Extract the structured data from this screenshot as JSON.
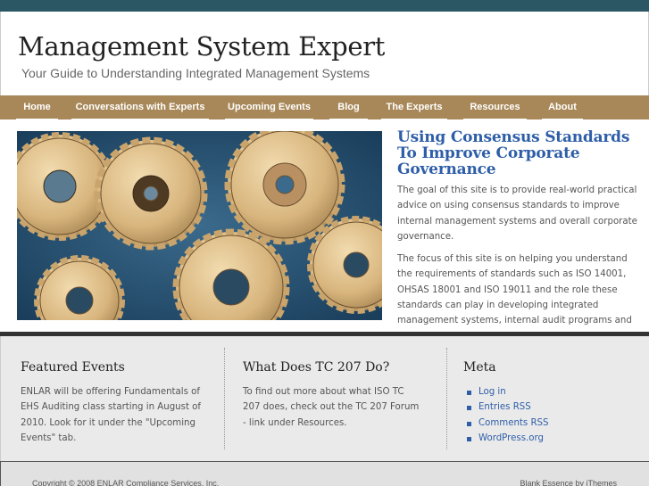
{
  "header": {
    "title": "Management System Expert",
    "tagline": "Your Guide to Understanding Integrated Management Systems"
  },
  "nav": {
    "items": [
      {
        "label": "Home"
      },
      {
        "label": "Conversations with Experts"
      },
      {
        "label": "Upcoming Events"
      },
      {
        "label": "Blog"
      },
      {
        "label": "The Experts"
      },
      {
        "label": "Resources"
      },
      {
        "label": "About"
      }
    ]
  },
  "hero": {
    "image_subject": "gears"
  },
  "article": {
    "title": "Using Consensus Standards To Improve Corporate Governance",
    "paragraph_1": "The goal of this site is to provide real-world practical advice on using consensus standards to improve internal management systems and overall corporate governance.",
    "paragraph_2": "The focus of this site is on helping you understand the requirements of standards such as ISO 14001, OHSAS 18001 and ISO 19011 and the role these standards can play in developing integrated management systems, internal audit programs and improved corporate governance."
  },
  "widgets": {
    "featured": {
      "title": "Featured Events",
      "body": "ENLAR will be offering Fundamentals of EHS Auditing class starting in August of 2010. Look for it under the \"Upcoming Events\" tab."
    },
    "tc207": {
      "title": "What Does TC 207 Do?",
      "body": "To find out more about what ISO TC 207 does, check out the TC 207 Forum - link under Resources."
    },
    "meta": {
      "title": "Meta",
      "links": [
        {
          "label": "Log in"
        },
        {
          "label": "Entries RSS"
        },
        {
          "label": "Comments RSS"
        },
        {
          "label": "WordPress.org"
        }
      ]
    }
  },
  "footer": {
    "copyright": "Copyright © 2008 ENLAR Compliance Services, Inc.",
    "credit": "Blank Essence by iThemes"
  },
  "colors": {
    "topbar": "#2b5765",
    "nav": "#a88858",
    "link": "#2e5ea8",
    "widgets_bg": "#eaeaea"
  }
}
